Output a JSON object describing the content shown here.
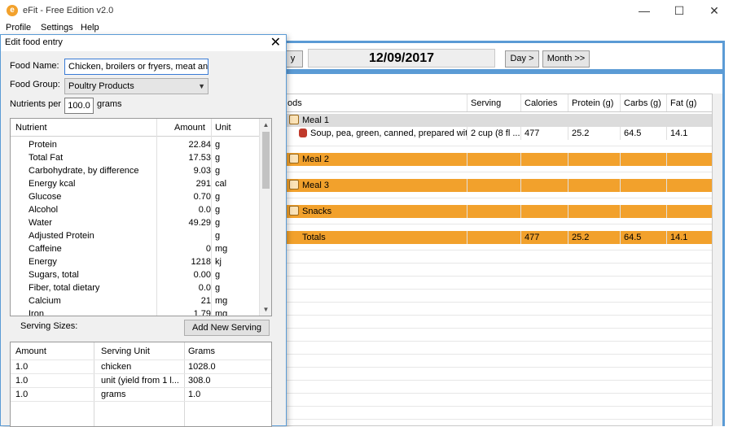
{
  "window": {
    "title": "eFit - Free Edition v2.0",
    "menu": [
      "Profile",
      "Settings",
      "Help"
    ]
  },
  "navigation": {
    "day_back_label": "y",
    "date": "12/09/2017",
    "day_forward_label": "Day >",
    "month_forward_label": "Month >>"
  },
  "log": {
    "columns": [
      "ods",
      "Serving",
      "Calories",
      "Protein (g)",
      "Carbs (g)",
      "Fat (g)"
    ],
    "meal1": {
      "label": "Meal 1"
    },
    "meal1_food": {
      "name": "Soup, pea, green, canned, prepared wit",
      "serving": "2 cup (8 fl ...",
      "calories": "477",
      "protein": "25.2",
      "carbs": "64.5",
      "fat": "14.1"
    },
    "meal2": {
      "label": "Meal 2"
    },
    "meal3": {
      "label": "Meal 3"
    },
    "snacks": {
      "label": "Snacks"
    },
    "totals": {
      "label": "Totals",
      "calories": "477",
      "protein": "25.2",
      "carbs": "64.5",
      "fat": "14.1"
    },
    "colors": {
      "meal_row": "#f2a12c",
      "panel_border": "#5b9bd5"
    }
  },
  "dialog": {
    "title": "Edit food entry",
    "food_name_label": "Food Name:",
    "food_name_value": "Chicken, broilers or fryers, meat and",
    "food_group_label": "Food Group:",
    "food_group_value": "Poultry Products",
    "nutrients_per_label": "Nutrients per",
    "nutrients_per_value": "100.0",
    "nutrients_per_unit": "grams",
    "nutrient_headers": {
      "nutrient": "Nutrient",
      "amount": "Amount",
      "unit": "Unit"
    },
    "nutrients": [
      {
        "name": "Protein",
        "amount": "22.84",
        "unit": "g"
      },
      {
        "name": "Total Fat",
        "amount": "17.53",
        "unit": "g"
      },
      {
        "name": "Carbohydrate, by difference",
        "amount": "9.03",
        "unit": "g"
      },
      {
        "name": "Energy kcal",
        "amount": "291",
        "unit": "cal"
      },
      {
        "name": "Glucose",
        "amount": "0.70",
        "unit": "g"
      },
      {
        "name": "Alcohol",
        "amount": "0.0",
        "unit": "g"
      },
      {
        "name": "Water",
        "amount": "49.29",
        "unit": "g"
      },
      {
        "name": "Adjusted Protein",
        "amount": "",
        "unit": "g"
      },
      {
        "name": "Caffeine",
        "amount": "0",
        "unit": "mg"
      },
      {
        "name": "Energy",
        "amount": "1218",
        "unit": "kj"
      },
      {
        "name": "Sugars, total",
        "amount": "0.00",
        "unit": "g"
      },
      {
        "name": "Fiber, total dietary",
        "amount": "0.0",
        "unit": "g"
      },
      {
        "name": "Calcium",
        "amount": "21",
        "unit": "mg"
      },
      {
        "name": "Iron",
        "amount": "1.79",
        "unit": "mg"
      }
    ],
    "serving_sizes_label": "Serving Sizes:",
    "add_serving_label": "Add New Serving",
    "serving_headers": {
      "amount": "Amount",
      "unit": "Serving Unit",
      "grams": "Grams"
    },
    "servings": [
      {
        "amount": "1.0",
        "unit": "chicken",
        "grams": "1028.0"
      },
      {
        "amount": "1.0",
        "unit": "unit (yield from 1 l...",
        "grams": "308.0"
      },
      {
        "amount": "1.0",
        "unit": "grams",
        "grams": "1.0"
      }
    ]
  }
}
